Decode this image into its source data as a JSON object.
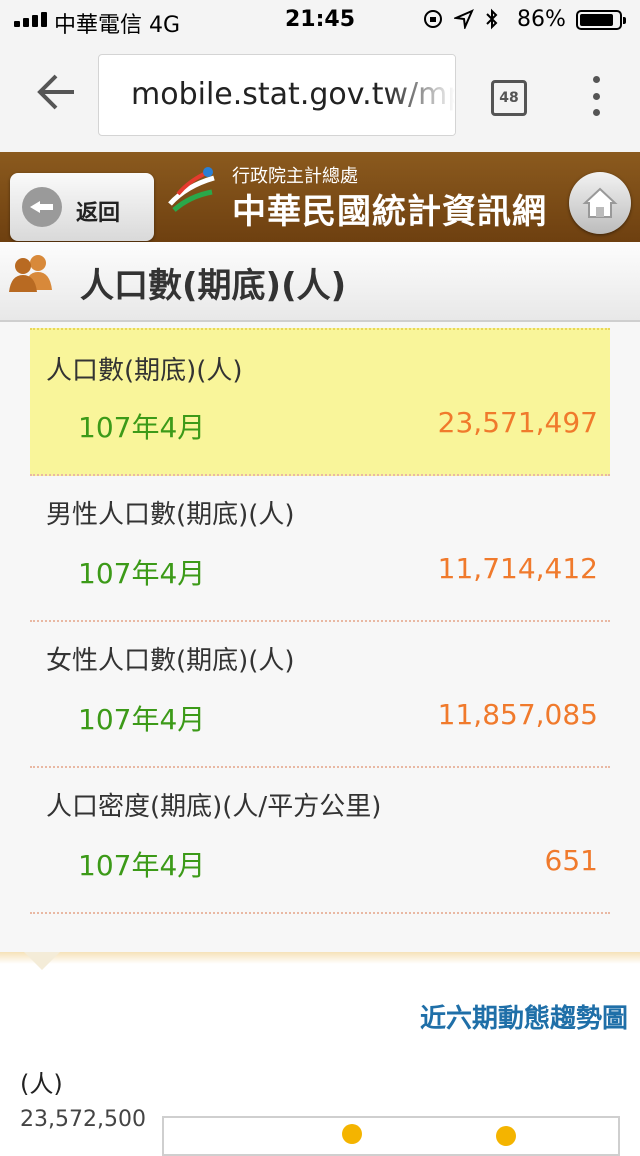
{
  "status_bar": {
    "carrier": "中華電信  4G",
    "time": "21:45",
    "battery_pct": "86%",
    "battery_level": 0.86
  },
  "browser": {
    "url": "mobile.stat.gov.tw/mp",
    "tab_count": "48"
  },
  "header": {
    "back_label": "返回",
    "site_subtitle": "行政院主計總處",
    "site_title": "中華民國統計資訊網"
  },
  "page": {
    "title": "人口數(期底)(人)"
  },
  "items": [
    {
      "label": "人口數(期底)(人)",
      "period": "107年4月",
      "value": "23,571,497"
    },
    {
      "label": "男性人口數(期底)(人)",
      "period": "107年4月",
      "value": "11,714,412"
    },
    {
      "label": "女性人口數(期底)(人)",
      "period": "107年4月",
      "value": "11,857,085"
    },
    {
      "label": "人口密度(期底)(人/平方公里)",
      "period": "107年4月",
      "value": "651"
    }
  ],
  "trend": {
    "link_label": "近六期動態趨勢圖",
    "unit": "(人)",
    "y_top_tick": "23,572,500"
  },
  "colors": {
    "header_brown": "#7a4a14",
    "highlight_yellow": "#f9f59a",
    "period_green": "#3c9a18",
    "value_orange": "#f07a2c",
    "link_blue": "#1f6fa8"
  }
}
